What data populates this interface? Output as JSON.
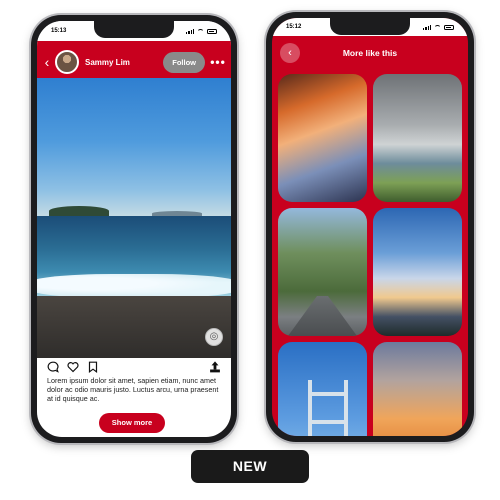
{
  "left_phone": {
    "status_time": "15:13",
    "profile": {
      "name": "Sammy Lim",
      "follow_label": "Follow"
    },
    "caption": "Lorem ipsum dolor sit amet, sapien etiam, nunc amet dolor ac odio mauris justo. Luctus arcu, urna praesent at id quisque ac.",
    "show_more_label": "Show more",
    "icons": [
      "back-icon",
      "more-icon",
      "lens-icon",
      "comment-icon",
      "heart-icon",
      "bookmark-icon",
      "share-icon"
    ]
  },
  "right_phone": {
    "status_time": "15:12",
    "title": "More like this",
    "tiles": [
      "sunset-clouds",
      "coastal-cliffs",
      "tree-lined-road",
      "evening-sky",
      "bridge-tower",
      "orange-sunset"
    ]
  },
  "badge_label": "NEW",
  "colors": {
    "accent": "#c8001e",
    "badge_bg": "#1a1a1a"
  }
}
